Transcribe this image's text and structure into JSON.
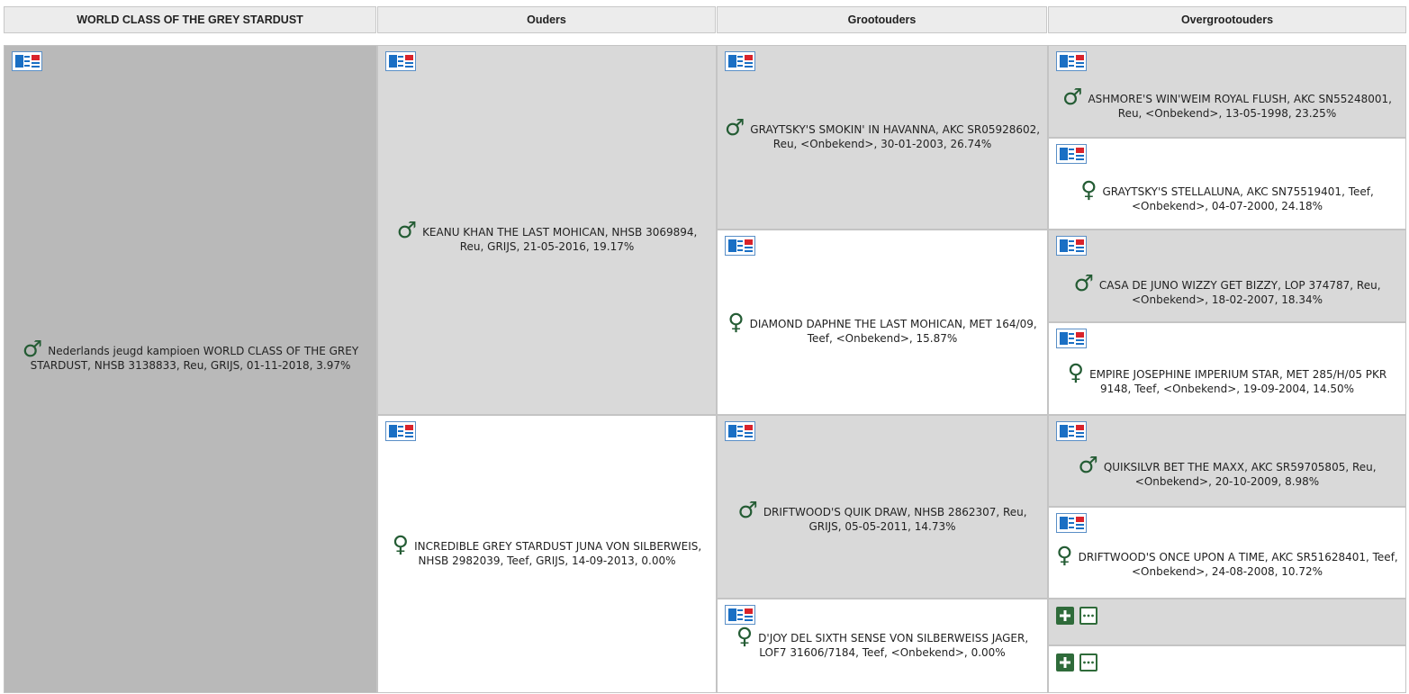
{
  "headers": {
    "subject": "WORLD CLASS OF THE GREY STARDUST",
    "parents": "Ouders",
    "grandparents": "Grootouders",
    "great_grandparents": "Overgrootouders"
  },
  "symbols": {
    "male": "♂",
    "female": "♀"
  },
  "colors": {
    "symbol_green": "#245c34",
    "card_blue": "#1a6fc4",
    "card_red": "#d9232b"
  },
  "icons": {
    "card": "pedigree-card-icon",
    "add": "plus-icon",
    "more": "more-icon"
  },
  "subject": {
    "sex": "male",
    "text": "Nederlands jeugd kampioen WORLD CLASS OF THE GREY STARDUST, NHSB 3138833, Reu, GRIJS, 01-11-2018, 3.97%"
  },
  "parents": [
    {
      "sex": "male",
      "text": "KEANU KHAN THE LAST MOHICAN, NHSB 3069894, Reu, GRIJS, 21-05-2016, 19.17%"
    },
    {
      "sex": "female",
      "text": "INCREDIBLE GREY STARDUST JUNA VON SILBERWEIS, NHSB 2982039, Teef, GRIJS, 14-09-2013, 0.00%"
    }
  ],
  "grandparents": [
    {
      "sex": "male",
      "text": "GRAYTSKY'S SMOKIN' IN HAVANNA, AKC SR05928602, Reu, <Onbekend>, 30-01-2003, 26.74%"
    },
    {
      "sex": "female",
      "text": "DIAMOND DAPHNE THE LAST MOHICAN, MET 164/09, Teef, <Onbekend>, 15.87%"
    },
    {
      "sex": "male",
      "text": "DRIFTWOOD'S QUIK DRAW, NHSB 2862307, Reu, GRIJS, 05-05-2011, 14.73%"
    },
    {
      "sex": "female",
      "text": "D'JOY DEL SIXTH SENSE VON SILBERWEISS JAGER, LOF7 31606/7184, Teef, <Onbekend>, 0.00%"
    }
  ],
  "great_grandparents": [
    {
      "sex": "male",
      "text": "ASHMORE'S WIN'WEIM ROYAL FLUSH, AKC SN55248001, Reu, <Onbekend>, 13-05-1998, 23.25%"
    },
    {
      "sex": "female",
      "text": "GRAYTSKY'S STELLALUNA, AKC SN75519401, Teef, <Onbekend>, 04-07-2000, 24.18%"
    },
    {
      "sex": "male",
      "text": "CASA DE JUNO WIZZY GET BIZZY, LOP 374787, Reu, <Onbekend>, 18-02-2007, 18.34%"
    },
    {
      "sex": "female",
      "text": "EMPIRE JOSEPHINE IMPERIUM STAR, MET 285/H/05 PKR 9148, Teef, <Onbekend>, 19-09-2004, 14.50%"
    },
    {
      "sex": "male",
      "text": "QUIKSILVR BET THE MAXX, AKC SR59705805, Reu, <Onbekend>, 20-10-2009, 8.98%"
    },
    {
      "sex": "female",
      "text": "DRIFTWOOD'S ONCE UPON A TIME, AKC SR51628401, Teef, <Onbekend>, 24-08-2008, 10.72%"
    }
  ]
}
